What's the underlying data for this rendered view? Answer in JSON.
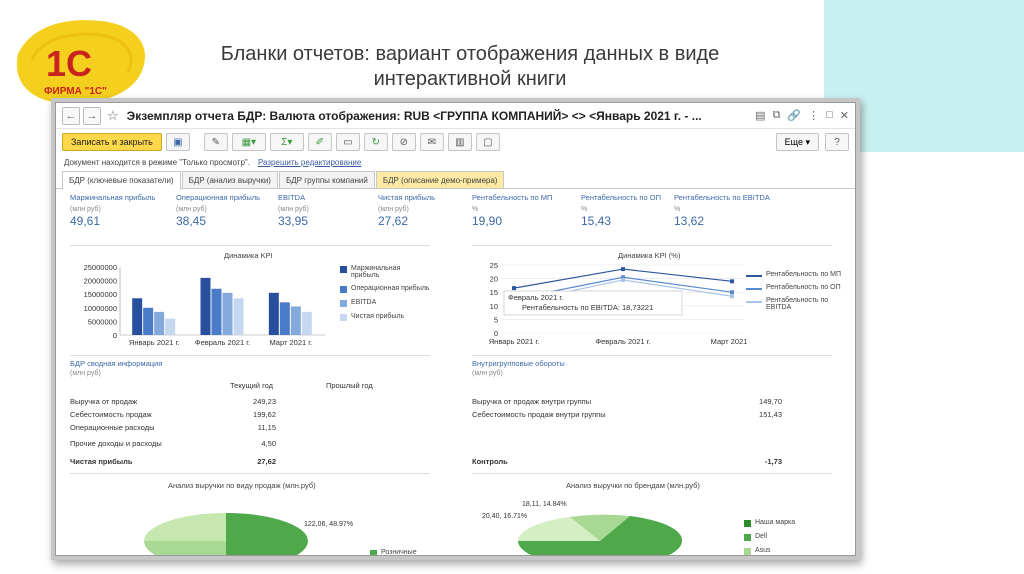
{
  "slide": {
    "title": "Бланки отчетов: вариант отображения данных в виде интерактивной книги",
    "logo_text": "ФИРМА \"1С\""
  },
  "window": {
    "title": "Экземпляр отчета БДР: Валюта отображения: RUB <ГРУППА КОМПАНИЙ> <> <Январь 2021 г. - ..."
  },
  "toolbar": {
    "save_close_label": "Записать и закрыть",
    "more_label": "Еще ▾",
    "help_label": "?"
  },
  "mode": {
    "text": "Документ находится в режиме \"Только просмотр\".",
    "link": "Разрешить редактирование"
  },
  "tabs": [
    {
      "label": "БДР (ключевые показатели)"
    },
    {
      "label": "БДР (анализ выручки)"
    },
    {
      "label": "БДР группы компаний"
    },
    {
      "label": "БДР (описание демо-примера)"
    }
  ],
  "kpis": [
    {
      "label": "Маржинальная прибыль",
      "unit": "(млн руб)",
      "value": "49,61"
    },
    {
      "label": "Операционная прибыль",
      "unit": "(млн руб)",
      "value": "38,45"
    },
    {
      "label": "EBITDA",
      "unit": "(млн руб)",
      "value": "33,95"
    },
    {
      "label": "Чистая прибыль",
      "unit": "(млн руб)",
      "value": "27,62"
    },
    {
      "label": "Рентабельность по МП",
      "unit": "%",
      "value": "19,90"
    },
    {
      "label": "Рентабельность по ОП",
      "unit": "%",
      "value": "15,43"
    },
    {
      "label": "Рентабельность по EBITDA",
      "unit": "%",
      "value": "13,62"
    }
  ],
  "chart_data": [
    {
      "type": "bar",
      "title": "Динамика KPI",
      "categories": [
        "Январь 2021 г.",
        "Февраль 2021 г.",
        "Март 2021 г."
      ],
      "ylim": [
        0,
        25000000
      ],
      "yticks": [
        "0",
        "5000000",
        "10000000",
        "15000000",
        "20000000",
        "25000000"
      ],
      "series": [
        {
          "name": "Маржинальная прибыль",
          "values": [
            13500000,
            21000000,
            15500000
          ],
          "color": "#274f9e"
        },
        {
          "name": "Операционная прибыль",
          "values": [
            10000000,
            17000000,
            12000000
          ],
          "color": "#4a7bc8"
        },
        {
          "name": "EBITDA",
          "values": [
            8500000,
            15500000,
            10500000
          ],
          "color": "#84a9dd"
        },
        {
          "name": "Чистая прибыль",
          "values": [
            6000000,
            13500000,
            8500000
          ],
          "color": "#c6d8ef"
        }
      ],
      "legend": "right",
      "grid": false
    },
    {
      "type": "line",
      "title": "Динамика KPI (%)",
      "categories": [
        "Январь 2021 г.",
        "Февраль 2021 г.",
        "Март 2021 г."
      ],
      "ylim": [
        0,
        25
      ],
      "yticks": [
        "0",
        "5",
        "10",
        "15",
        "20",
        "25"
      ],
      "series": [
        {
          "name": "Рентабельность по МП",
          "values": [
            16.5,
            23.5,
            19
          ],
          "color": "#2c56a0"
        },
        {
          "name": "Рентабельность по ОП",
          "values": [
            12.5,
            20.5,
            15
          ],
          "color": "#5a8ad0"
        },
        {
          "name": "Рентабельность по EBITDA",
          "values": [
            11,
            19.5,
            13.5
          ],
          "color": "#a9c3e8"
        }
      ],
      "tooltip": "Рентабельность по EBITDA: 18,73221",
      "tooltip_category": "Февраль 2021 г.",
      "legend": "right",
      "grid": true
    }
  ],
  "summary": {
    "title": "БДР сводная информация",
    "unit": "(млн руб)",
    "col_current": "Текущий год",
    "col_prev": "Прошлый год",
    "rows": [
      {
        "label": "Выручка от продаж",
        "value": "249,23"
      },
      {
        "label": "Себестоимость продаж",
        "value": "199,62"
      },
      {
        "label": "Операционные расходы",
        "value": "11,15"
      },
      {
        "label": "Прочие доходы и расходы",
        "value": "4,50"
      }
    ],
    "total": {
      "label": "Чистая прибыль",
      "value": "27,62"
    }
  },
  "intragroup": {
    "title": "Внутригрупповые обороты",
    "unit": "(млн руб)",
    "rows": [
      {
        "label": "Выручка от продаж внутри группы",
        "value": "149,70"
      },
      {
        "label": "Себестоимость продаж внутри группы",
        "value": "151,43"
      }
    ],
    "total": {
      "label": "Контроль",
      "value": "-1,73"
    }
  },
  "pie_left": {
    "title": "Анализ выручки по виду продаж (млн.руб)",
    "label": "122,06, 48.97%",
    "legend": [
      "Розничные"
    ]
  },
  "pie_right": {
    "title": "Анализ выручки по брендам (млн.руб)",
    "labels": [
      "18,11, 14.84%",
      "20,40, 16.71%"
    ],
    "legend": [
      "Наша марка",
      "Dell",
      "Asus"
    ]
  }
}
